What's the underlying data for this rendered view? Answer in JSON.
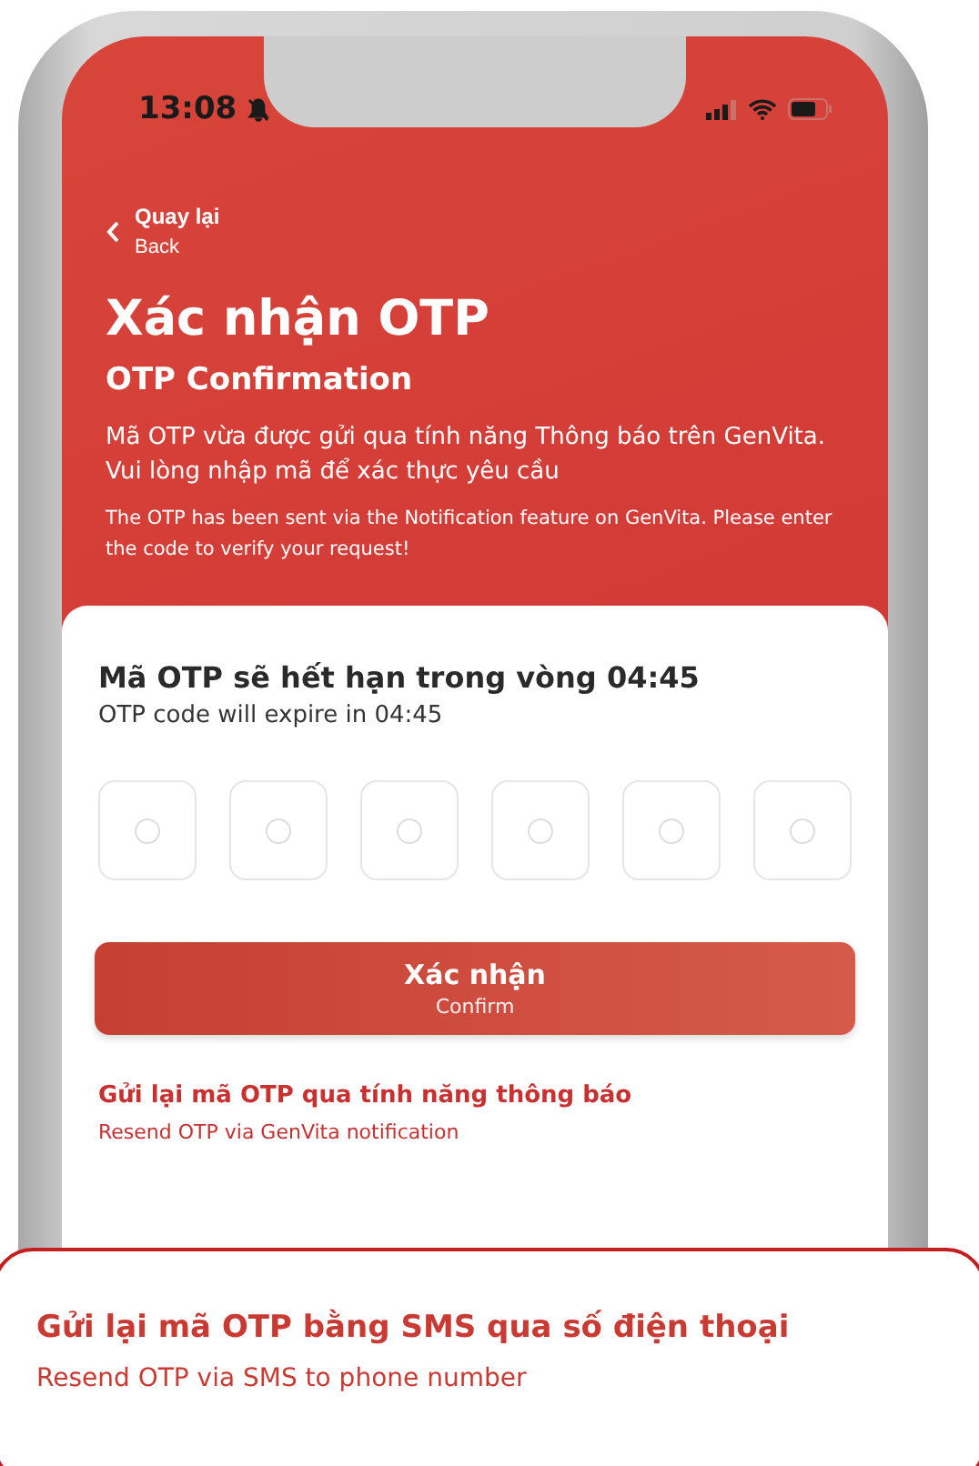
{
  "status_bar": {
    "time": "13:08"
  },
  "back": {
    "label": "Quay lại",
    "sublabel": "Back"
  },
  "header": {
    "title": "Xác nhận OTP",
    "subtitle": "OTP Confirmation",
    "message": "Mã OTP vừa được gửi qua tính năng Thông báo trên GenVita. Vui lòng nhập mã để xác thực yêu cầu",
    "message_en": "The OTP has been sent via the Notification feature on GenVita. Please enter the code to verify your request!"
  },
  "expiry": {
    "text": "Mã OTP sẽ hết hạn trong vòng 04:45",
    "text_en": "OTP code will expire in 04:45"
  },
  "otp_digits": [
    {
      "filled": false
    },
    {
      "filled": false
    },
    {
      "filled": false
    },
    {
      "filled": false
    },
    {
      "filled": false
    },
    {
      "filled": false
    }
  ],
  "confirm_button": {
    "label": "Xác nhận",
    "sublabel": "Confirm"
  },
  "resend_notification": {
    "label": "Gửi lại mã OTP qua tính năng thông báo",
    "sublabel": "Resend OTP via GenVita notification"
  },
  "resend_sms_callout": {
    "label": "Gửi lại mã OTP bằng SMS qua số điện thoại",
    "sublabel": "Resend OTP via SMS to phone number"
  }
}
